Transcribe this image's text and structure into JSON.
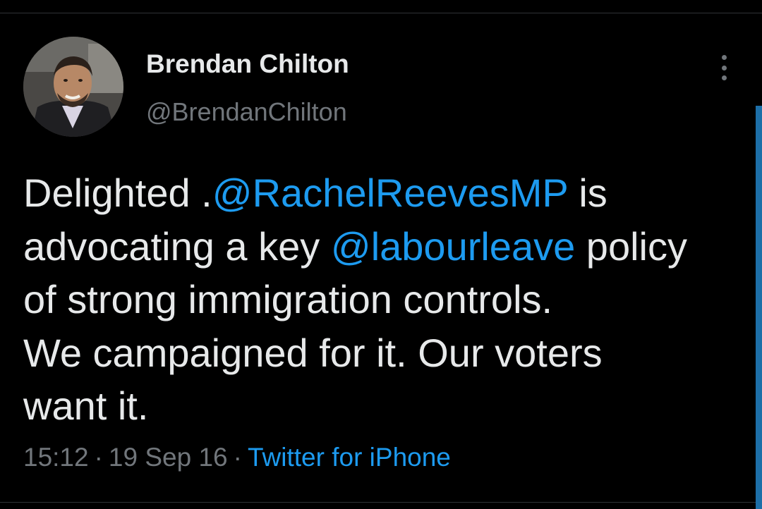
{
  "tweet": {
    "author": {
      "name": "Brendan Chilton",
      "handle": "@BrendanChilton"
    },
    "text_lines": [
      [
        {
          "text": "Delighted .",
          "type": "text"
        },
        {
          "text": "@RachelReevesMP",
          "type": "mention"
        },
        {
          "text": " is",
          "type": "text"
        }
      ],
      [
        {
          "text": "advocating a key ",
          "type": "text"
        },
        {
          "text": "@labourleave",
          "type": "mention"
        },
        {
          "text": " policy",
          "type": "text"
        }
      ],
      [
        {
          "text": "of strong immigration controls.",
          "type": "text"
        }
      ],
      [
        {
          "text": "We campaigned for it. Our voters",
          "type": "text"
        }
      ],
      [
        {
          "text": "want it.",
          "type": "text"
        }
      ]
    ],
    "meta": {
      "time": "15:12",
      "separator": "·",
      "date": "19 Sep 16",
      "source": "Twitter for iPhone"
    }
  },
  "icons": {
    "more": "more-vertical-icon"
  },
  "colors": {
    "background": "#000000",
    "text": "#e7e9ea",
    "muted": "#71767b",
    "link": "#1d9bf0",
    "divider": "#2f3336"
  }
}
